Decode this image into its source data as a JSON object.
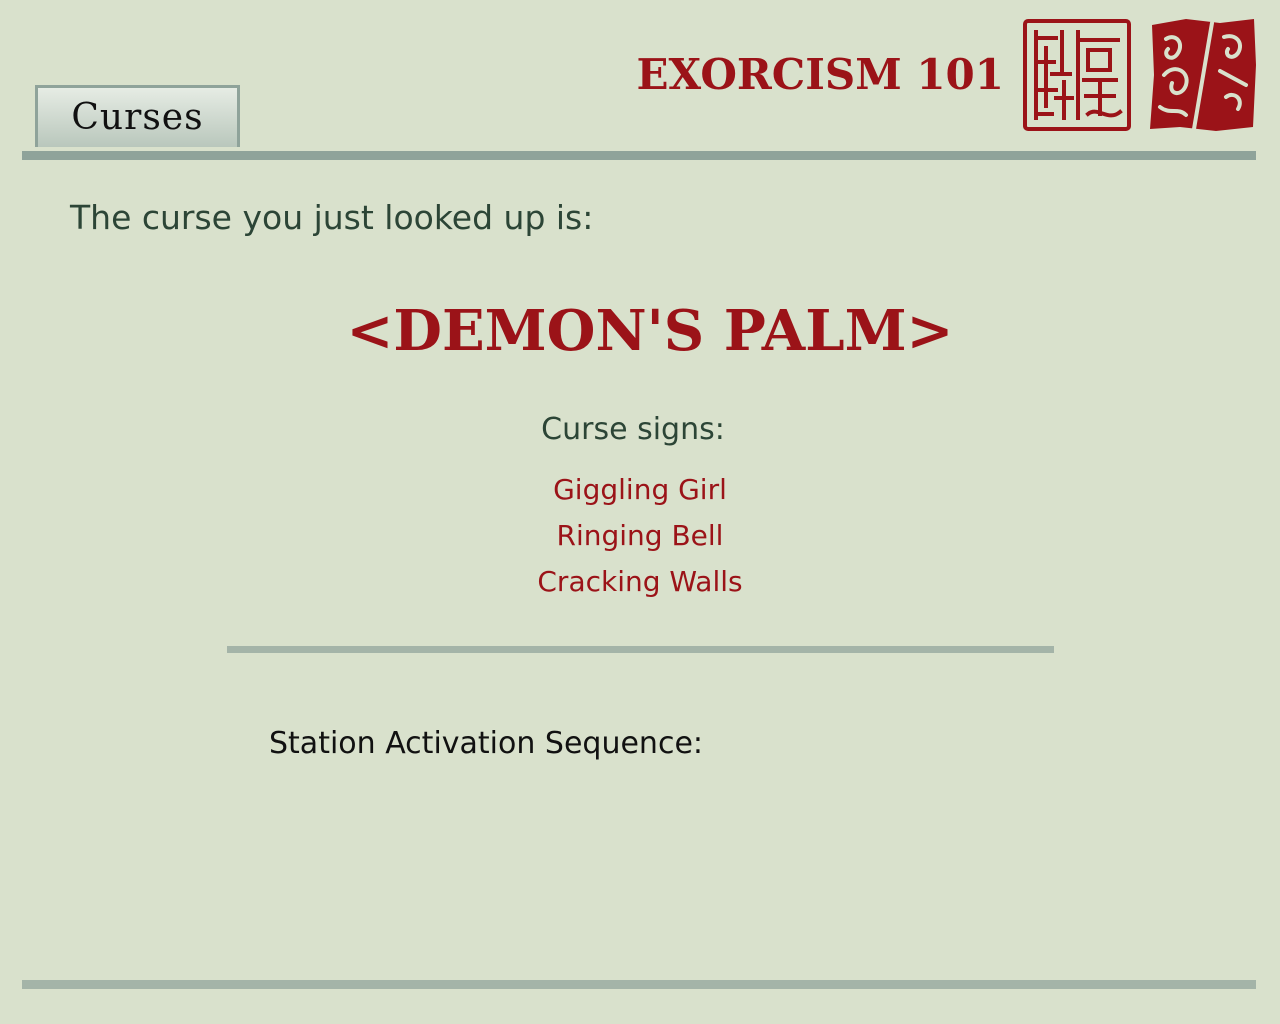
{
  "tabs": [
    {
      "label": "Curses"
    }
  ],
  "app_title": "EXORCISM 101",
  "colors": {
    "background": "#d9e1cc",
    "accent_red": "#9b1318",
    "text_dark_green": "#2c4536",
    "rule_gray_green": "#8fa39a"
  },
  "icons": [
    "seal-stamp-icon",
    "seal-stamp-icon"
  ],
  "intro_text": "The curse you just looked up is:",
  "curse": {
    "name": "<DEMON'S PALM>",
    "signs_label": "Curse signs:",
    "signs": [
      "Giggling Girl",
      "Ringing Bell",
      "Cracking Walls"
    ]
  },
  "station": {
    "label": "Station Activation Sequence:"
  }
}
